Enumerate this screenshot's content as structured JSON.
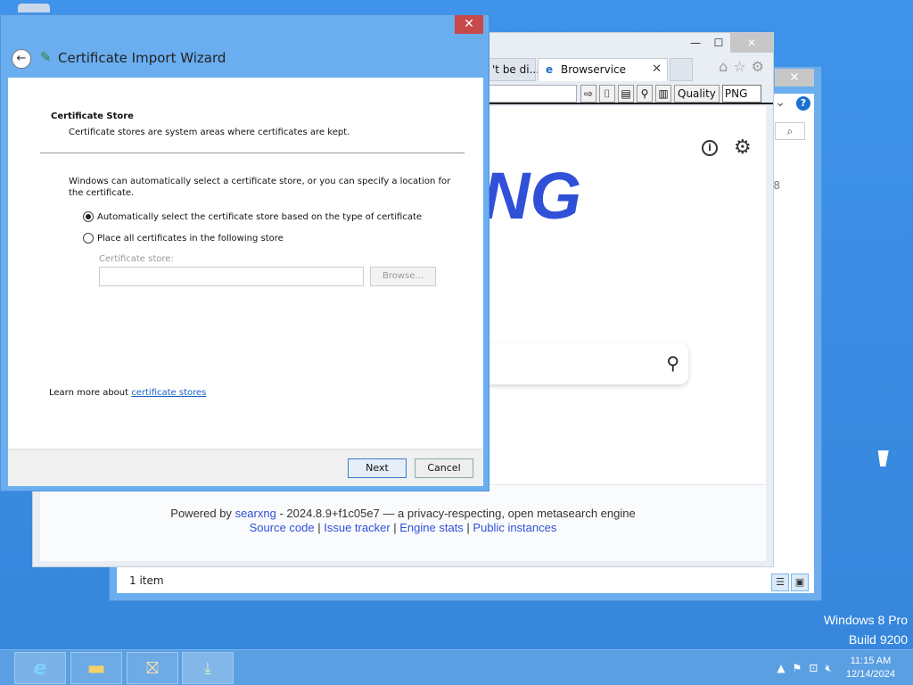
{
  "desktop": {
    "watermark_line1": "Windows 8 Pro",
    "watermark_line2": "Build 9200"
  },
  "explorer": {
    "status": "1 item",
    "help_icon": "?",
    "number_fragment": "8"
  },
  "browser": {
    "tabs": [
      {
        "label": "'t be di..."
      },
      {
        "label": "Browservice"
      }
    ],
    "quality_label": "Quality",
    "format_value": "PNG",
    "logo_text": "NG",
    "footer": {
      "powered_by": "Powered by",
      "engine_link": "searxng",
      "version_text": "- 2024.8.9+f1c05e7 — a privacy-respecting, open metasearch engine",
      "links": [
        "Source code",
        "Issue tracker",
        "Engine stats",
        "Public instances"
      ],
      "separator": " | "
    }
  },
  "wizard": {
    "title": "Certificate Import Wizard",
    "section_title": "Certificate Store",
    "section_desc": "Certificate stores are system areas where certificates are kept.",
    "intro": "Windows can automatically select a certificate store, or you can specify a location for the certificate.",
    "option_auto": "Automatically select the certificate store based on the type of certificate",
    "option_manual": "Place all certificates in the following store",
    "store_label": "Certificate store:",
    "store_value": "",
    "browse_label": "Browse...",
    "learn_prefix": "Learn more about",
    "learn_link": "certificate stores",
    "next_label": "Next",
    "cancel_label": "Cancel",
    "selected_option": "auto"
  },
  "taskbar": {
    "time": "11:15 AM",
    "date": "12/14/2024"
  },
  "colors": {
    "desktop": "#3a8ee6",
    "logo": "#3050d8",
    "link": "#1a5fc6",
    "close_button": "#c74a4a"
  }
}
